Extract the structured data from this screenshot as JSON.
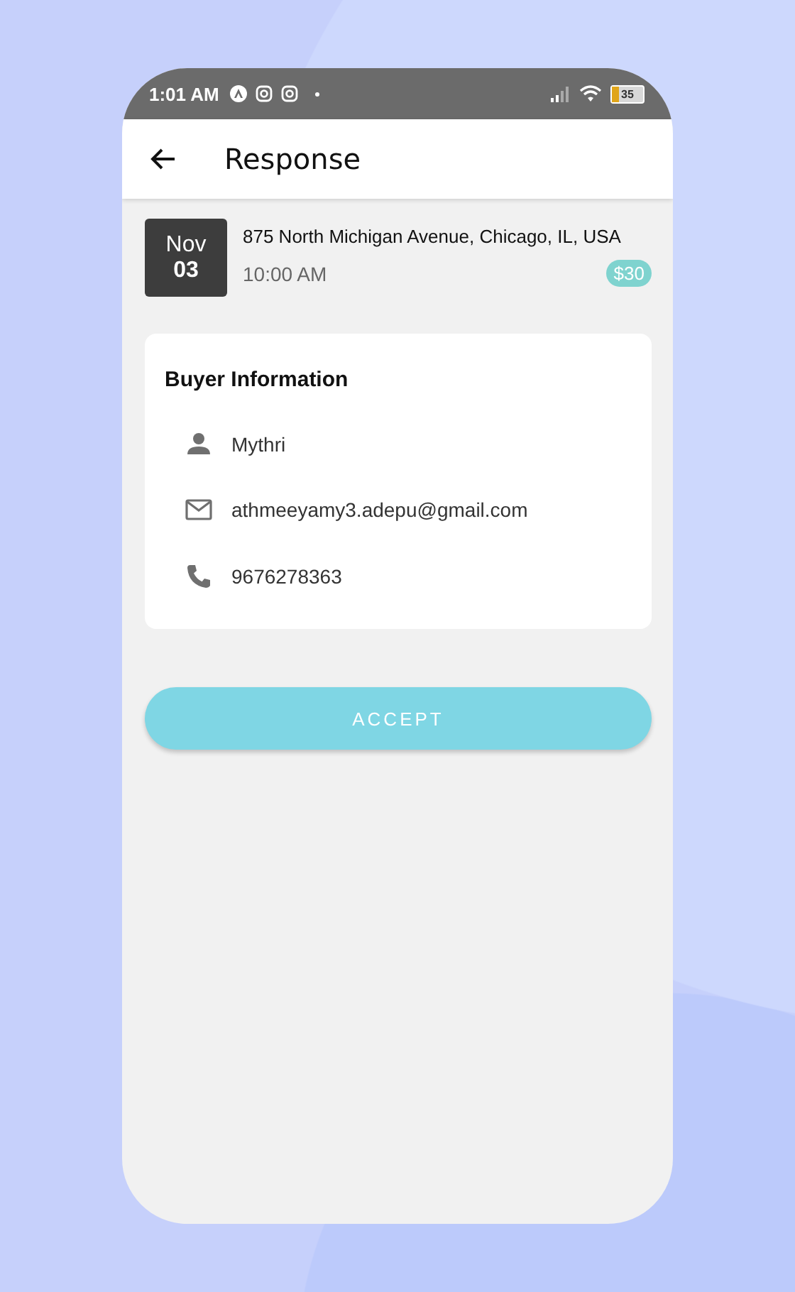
{
  "status_bar": {
    "time": "1:01 AM",
    "battery": "35"
  },
  "app_bar": {
    "title": "Response"
  },
  "event": {
    "month": "Nov",
    "day": "03",
    "address": "875 North Michigan Avenue, Chicago, IL, USA",
    "time": "10:00 AM",
    "price": "$30"
  },
  "buyer": {
    "title": "Buyer Information",
    "fields": [
      {
        "kind": "person",
        "value": "Mythri"
      },
      {
        "kind": "email",
        "value": "athmeeyamy3.adepu@gmail.com"
      },
      {
        "kind": "phone",
        "value": "9676278363"
      }
    ]
  },
  "buttons": [
    "ACCEPT"
  ]
}
